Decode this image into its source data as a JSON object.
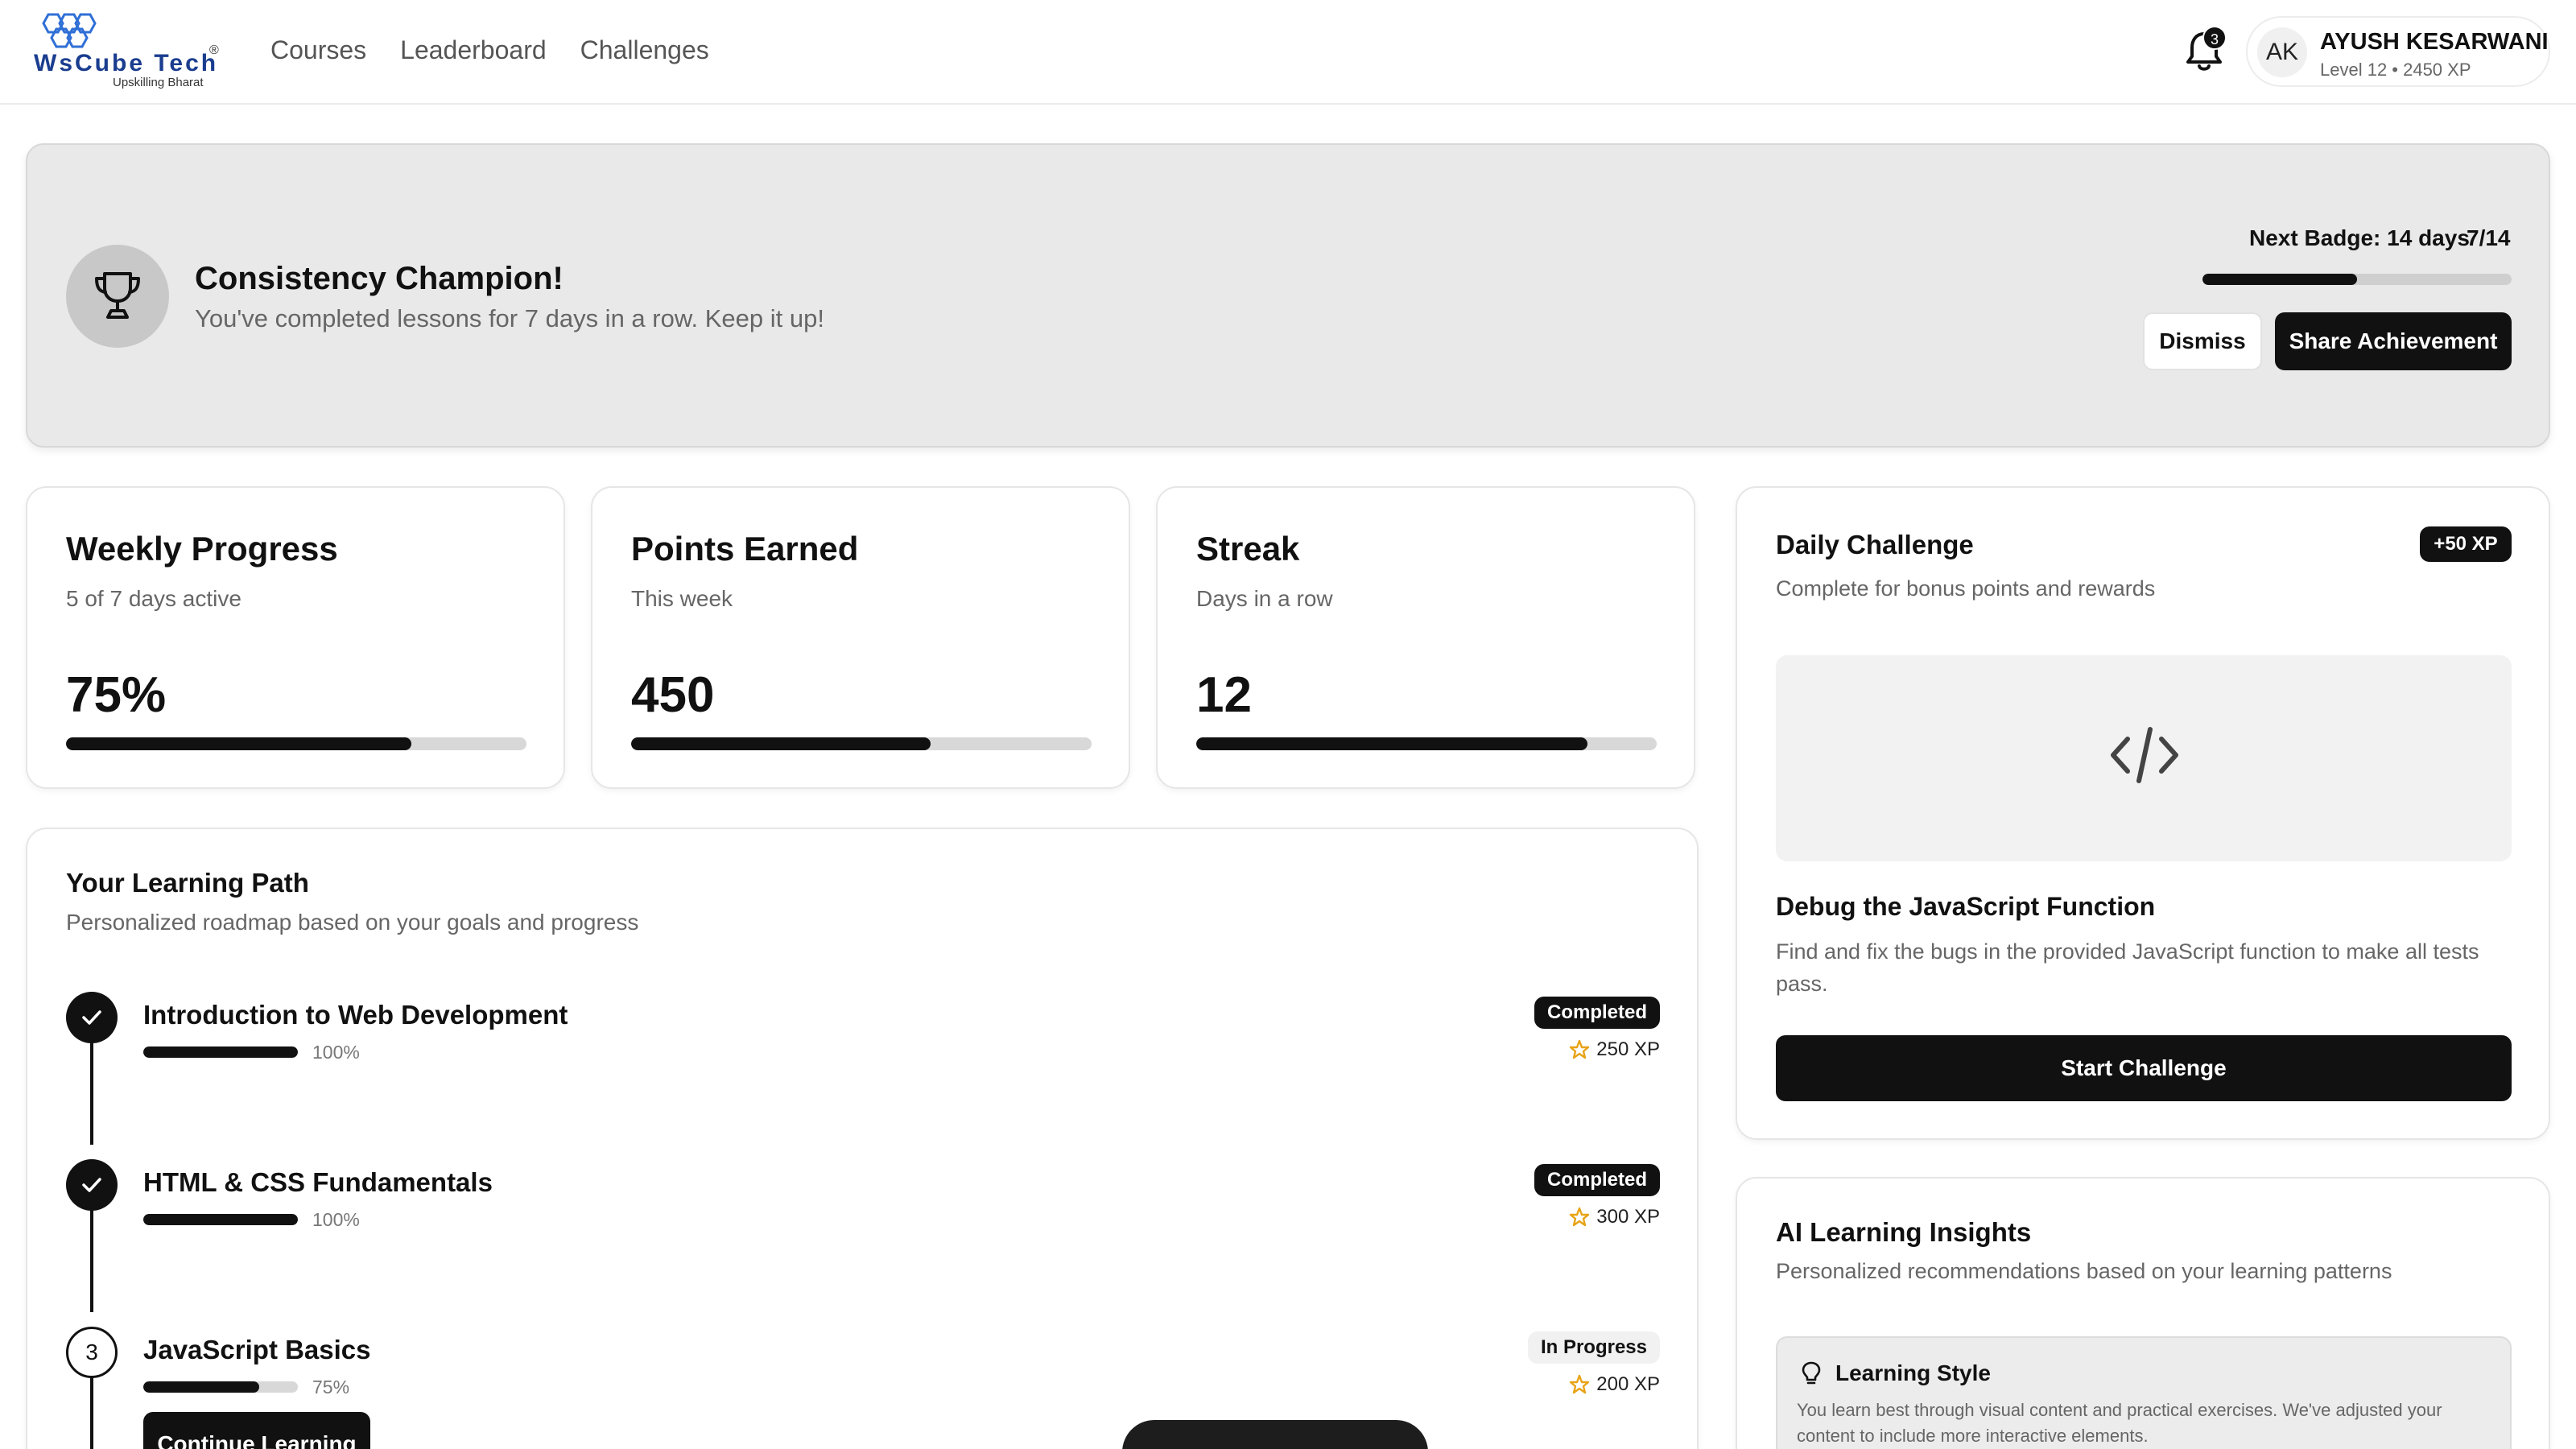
{
  "brand": {
    "name": "WsCube Tech",
    "tagline": "Upskilling Bharat",
    "reg": "®"
  },
  "nav": {
    "courses": "Courses",
    "leaderboard": "Leaderboard",
    "challenges": "Challenges"
  },
  "notifications": {
    "count": "3"
  },
  "profile": {
    "initials": "AK",
    "name": "AYUSH KESARWANI",
    "level": "Level 12 • 2450 XP"
  },
  "achievement": {
    "icon": "trophy-icon",
    "title": "Consistency Champion!",
    "subtitle": "You've completed lessons for 7 days in a row. Keep it up!",
    "next_badge": "Next Badge: 14 days",
    "count": "7/14",
    "progress": 0.5,
    "dismiss_label": "Dismiss",
    "share_label": "Share Achievement"
  },
  "stats": [
    {
      "title": "Weekly Progress",
      "subtitle": "5 of 7 days active",
      "value": "75%",
      "progress": 0.75
    },
    {
      "title": "Points Earned",
      "subtitle": "This week",
      "value": "450",
      "progress": 0.65
    },
    {
      "title": "Streak",
      "subtitle": "Days in a row",
      "value": "12",
      "progress": 0.85
    }
  ],
  "daily_challenge": {
    "title": "Daily Challenge",
    "xp": "+50 XP",
    "subtitle": "Complete for bonus points and rewards",
    "icon": "code-icon",
    "heading": "Debug the JavaScript Function",
    "description": "Find and fix the bugs in the provided JavaScript function to make all tests pass.",
    "button": "Start Challenge"
  },
  "learning_path": {
    "title": "Your Learning Path",
    "subtitle": "Personalized roadmap based on your goals and progress",
    "steps": [
      {
        "name": "Introduction to Web Development",
        "percent": "100%",
        "progress": 1.0,
        "status": "Completed",
        "xp": "250 XP",
        "state": "done"
      },
      {
        "name": "HTML & CSS Fundamentals",
        "percent": "100%",
        "progress": 1.0,
        "status": "Completed",
        "xp": "300 XP",
        "state": "done"
      },
      {
        "name": "JavaScript Basics",
        "percent": "75%",
        "progress": 0.75,
        "status": "In Progress",
        "xp": "200 XP",
        "state": "current",
        "number": "3"
      }
    ],
    "continue_label": "Continue Learning"
  },
  "ai_insights": {
    "title": "AI Learning Insights",
    "subtitle": "Personalized recommendations based on your learning patterns",
    "card_title": "Learning Style",
    "card_icon": "lightbulb-icon",
    "card_text": "You learn best through visual content and practical exercises. We've adjusted your content to include more interactive elements."
  },
  "colors": {
    "accent": "#111111",
    "star": "#e8a317",
    "banner_bg": "#e9e9e9",
    "muted_text": "#666666"
  }
}
